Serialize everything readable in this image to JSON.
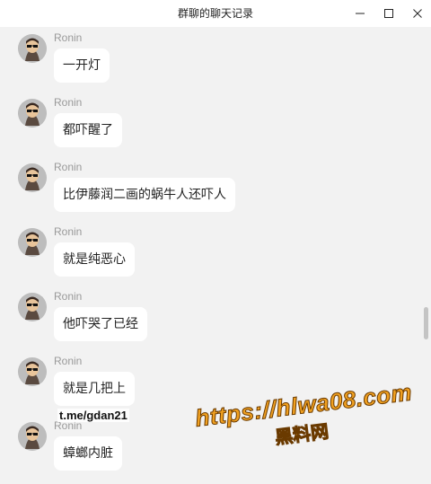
{
  "window": {
    "title": "群聊的聊天记录"
  },
  "messages": [
    {
      "sender": "Ronin",
      "text": "一开灯"
    },
    {
      "sender": "Ronin",
      "text": "都吓醒了"
    },
    {
      "sender": "Ronin",
      "text": "比伊藤润二画的蜗牛人还吓人"
    },
    {
      "sender": "Ronin",
      "text": "就是纯恶心"
    },
    {
      "sender": "Ronin",
      "text": "他吓哭了已经"
    },
    {
      "sender": "Ronin",
      "text": "就是几把上"
    },
    {
      "sender": "Ronin",
      "text": "蟑螂内脏"
    }
  ],
  "overlay": {
    "handle": "t.me/gdan21",
    "watermark_url": "https://hlwa08.com",
    "watermark_name": "黑料网"
  },
  "colors": {
    "background": "#f2f2f2",
    "bubble": "#ffffff",
    "sender": "#9a9a9a",
    "watermark": "#f0a020"
  }
}
